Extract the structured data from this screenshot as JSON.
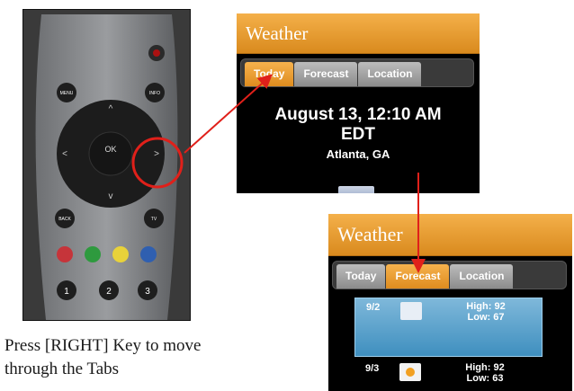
{
  "caption": {
    "line1": "Press [RIGHT] Key to move",
    "line2": "through the Tabs"
  },
  "remote": {
    "menu": "MENU",
    "info": "INFO",
    "back": "BACK",
    "tv": "TV",
    "ok": "OK",
    "keys": [
      "1",
      "2",
      "3"
    ]
  },
  "widget_top": {
    "title": "Weather",
    "tabs": [
      "Today",
      "Forecast",
      "Location"
    ],
    "active_tab": "Today",
    "datetime": "August 13, 12:10 AM",
    "timezone": "EDT",
    "city": "Atlanta, GA"
  },
  "widget_bottom": {
    "title": "Weather",
    "tabs": [
      "Today",
      "Forecast",
      "Location"
    ],
    "active_tab": "Forecast",
    "rows": [
      {
        "date": "9/2",
        "high": "High: 92",
        "low": "Low: 67"
      },
      {
        "date": "9/3",
        "high": "High: 92",
        "low": "Low: 63"
      }
    ]
  },
  "colors": {
    "accent": "#e09428",
    "arrow": "#e0201a",
    "selected_row": "#4f9bc8"
  }
}
